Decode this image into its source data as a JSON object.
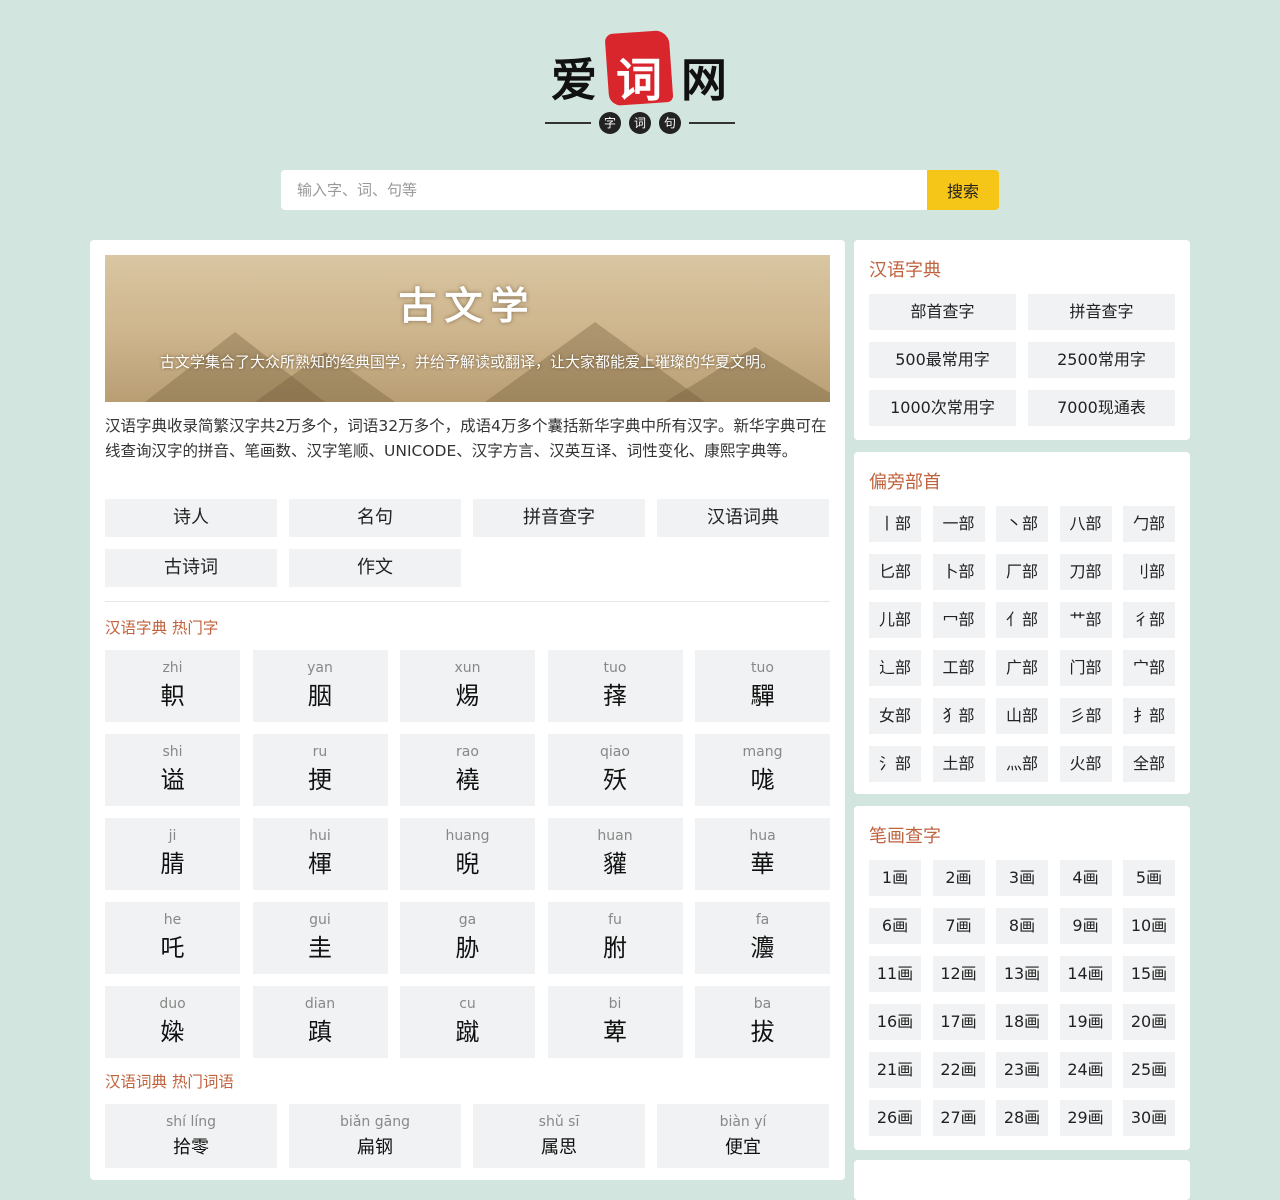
{
  "logo": {
    "char1": "爱",
    "char2": "词",
    "char3": "网",
    "dots": [
      "字",
      "词",
      "句"
    ]
  },
  "search": {
    "placeholder": "输入字、词、句等",
    "button_label": "搜索"
  },
  "banner": {
    "title": "古文学",
    "subtitle": "古文学集合了大众所熟知的经典国学，并给予解读或翻译，让大家都能爱上璀璨的华夏文明。"
  },
  "intro": "汉语字典收录简繁汉字共2万多个，词语32万多个，成语4万多个囊括新华字典中所有汉字。新华字典可在线查询汉字的拼音、笔画数、汉字笔顺、UNICODE、汉字方言、汉英互译、词性变化、康熙字典等。",
  "links": [
    "诗人",
    "名句",
    "拼音查字",
    "汉语词典",
    "古诗词",
    "作文"
  ],
  "hot_chars_title": "汉语字典 热门字",
  "hot_chars": [
    {
      "py": "zhi",
      "hz": "軹"
    },
    {
      "py": "yan",
      "hz": "胭"
    },
    {
      "py": "xun",
      "hz": "焬"
    },
    {
      "py": "tuo",
      "hz": "萚"
    },
    {
      "py": "tuo",
      "hz": "驒"
    },
    {
      "py": "shi",
      "hz": "谥"
    },
    {
      "py": "ru",
      "hz": "挭"
    },
    {
      "py": "rao",
      "hz": "襓"
    },
    {
      "py": "qiao",
      "hz": "殀"
    },
    {
      "py": "mang",
      "hz": "哤"
    },
    {
      "py": "ji",
      "hz": "腈"
    },
    {
      "py": "hui",
      "hz": "楎"
    },
    {
      "py": "huang",
      "hz": "晲"
    },
    {
      "py": "huan",
      "hz": "貛"
    },
    {
      "py": "hua",
      "hz": "華"
    },
    {
      "py": "he",
      "hz": "吒"
    },
    {
      "py": "gui",
      "hz": "圭"
    },
    {
      "py": "ga",
      "hz": "胁"
    },
    {
      "py": "fu",
      "hz": "胕"
    },
    {
      "py": "fa",
      "hz": "灋"
    },
    {
      "py": "duo",
      "hz": "媣"
    },
    {
      "py": "dian",
      "hz": "蹎"
    },
    {
      "py": "cu",
      "hz": "蹴"
    },
    {
      "py": "bi",
      "hz": "萆"
    },
    {
      "py": "ba",
      "hz": "拔"
    }
  ],
  "hot_words_title": "汉语词典 热门词语",
  "hot_words": [
    {
      "py": "shí líng",
      "hz": "拾零"
    },
    {
      "py": "biǎn gāng",
      "hz": "扁钢"
    },
    {
      "py": "shǔ sī",
      "hz": "属思"
    },
    {
      "py": "biàn yí",
      "hz": "便宜"
    }
  ],
  "dict_box": {
    "title": "汉语字典",
    "items": [
      "部首查字",
      "拼音查字",
      "500最常用字",
      "2500常用字",
      "1000次常用字",
      "7000现通表"
    ]
  },
  "radical_box": {
    "title": "偏旁部首",
    "items": [
      "丨部",
      "一部",
      "丶部",
      "八部",
      "勹部",
      "匕部",
      "卜部",
      "厂部",
      "刀部",
      "刂部",
      "儿部",
      "冖部",
      "亻部",
      "艹部",
      "彳部",
      "辶部",
      "工部",
      "广部",
      "门部",
      "宀部",
      "女部",
      "犭部",
      "山部",
      "彡部",
      "扌部",
      "氵部",
      "土部",
      "灬部",
      "火部",
      "全部"
    ]
  },
  "stroke_box": {
    "title": "笔画查字",
    "items": [
      "1画",
      "2画",
      "3画",
      "4画",
      "5画",
      "6画",
      "7画",
      "8画",
      "9画",
      "10画",
      "11画",
      "12画",
      "13画",
      "14画",
      "15画",
      "16画",
      "17画",
      "18画",
      "19画",
      "20画",
      "21画",
      "22画",
      "23画",
      "24画",
      "25画",
      "26画",
      "27画",
      "28画",
      "29画",
      "30画"
    ]
  }
}
